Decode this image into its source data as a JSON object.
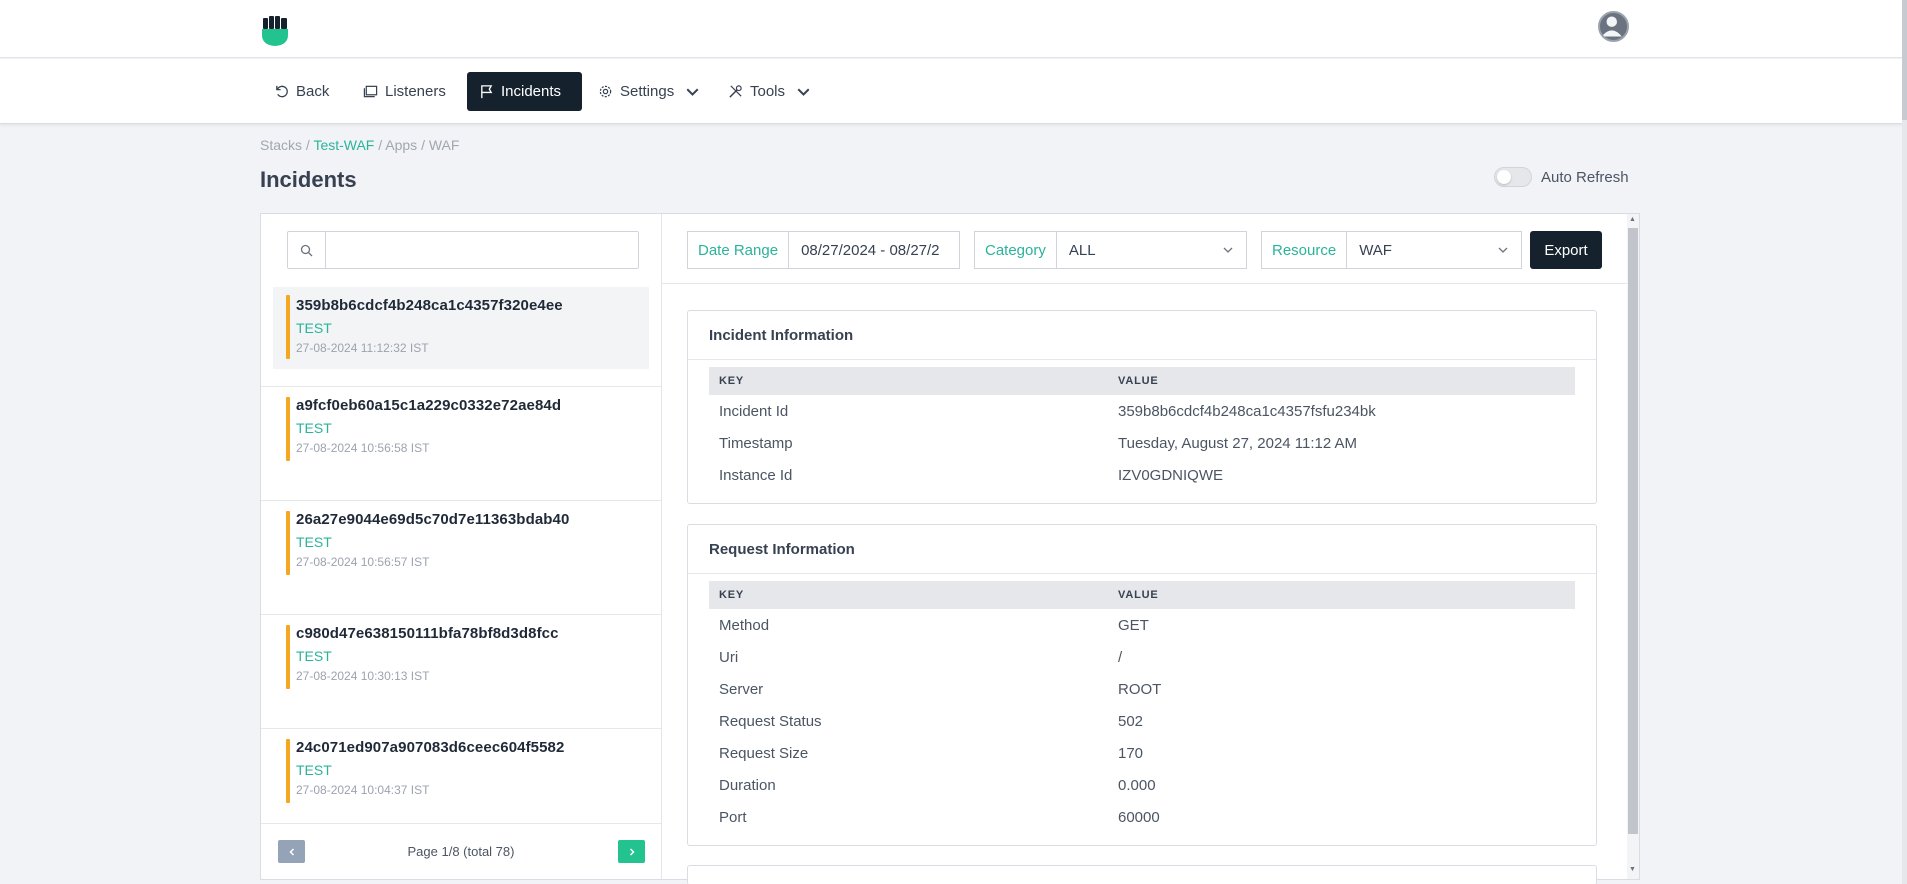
{
  "nav": {
    "back": "Back",
    "listeners": "Listeners",
    "incidents": "Incidents",
    "settings": "Settings",
    "tools": "Tools"
  },
  "breadcrumb": {
    "stacks": "Stacks",
    "sep": " / ",
    "stack_name": "Test-WAF",
    "apps": "Apps",
    "app": "WAF"
  },
  "page_title": "Incidents",
  "auto_refresh": {
    "label": "Auto Refresh",
    "enabled": false
  },
  "search": {
    "value": "",
    "placeholder": ""
  },
  "incidents": [
    {
      "id": "359b8b6cdcf4b248ca1c4357f320e4ee",
      "category": "TEST",
      "time": "27-08-2024 11:12:32 IST",
      "selected": true
    },
    {
      "id": "a9fcf0eb60a15c1a229c0332e72ae84d",
      "category": "TEST",
      "time": "27-08-2024 10:56:58 IST"
    },
    {
      "id": "26a27e9044e69d5c70d7e11363bdab40",
      "category": "TEST",
      "time": "27-08-2024 10:56:57 IST"
    },
    {
      "id": "c980d47e638150111bfa78bf8d3d8fcc",
      "category": "TEST",
      "time": "27-08-2024 10:30:13 IST"
    },
    {
      "id": "24c071ed907a907083d6ceec604f5582",
      "category": "TEST",
      "time": "27-08-2024 10:04:37 IST"
    }
  ],
  "pager": {
    "text": "Page 1/8 (total 78)"
  },
  "filters": {
    "date_range_label": "Date Range",
    "date_range_value": "08/27/2024 - 08/27/2",
    "category_label": "Category",
    "category_value": "ALL",
    "resource_label": "Resource",
    "resource_value": "WAF",
    "export_label": "Export"
  },
  "incident_info": {
    "title": "Incident Information",
    "key_header": "KEY",
    "value_header": "VALUE",
    "rows": [
      {
        "key": "Incident Id",
        "value": "359b8b6cdcf4b248ca1c4357fsfu234bk"
      },
      {
        "key": "Timestamp",
        "value": "Tuesday, August 27, 2024 11:12 AM"
      },
      {
        "key": "Instance Id",
        "value": "IZV0GDNIQWE"
      }
    ]
  },
  "request_info": {
    "title": "Request Information",
    "key_header": "KEY",
    "value_header": "VALUE",
    "rows": [
      {
        "key": "Method",
        "value": "GET"
      },
      {
        "key": "Uri",
        "value": "/"
      },
      {
        "key": "Server",
        "value": "ROOT"
      },
      {
        "key": "Request Status",
        "value": "502"
      },
      {
        "key": "Request Size",
        "value": "170"
      },
      {
        "key": "Duration",
        "value": "0.000"
      },
      {
        "key": "Port",
        "value": "60000"
      }
    ]
  },
  "colors": {
    "accent": "#2bb39a",
    "dark": "#15222e",
    "warning_bar": "#f5a623",
    "next_button": "#22c38e"
  }
}
